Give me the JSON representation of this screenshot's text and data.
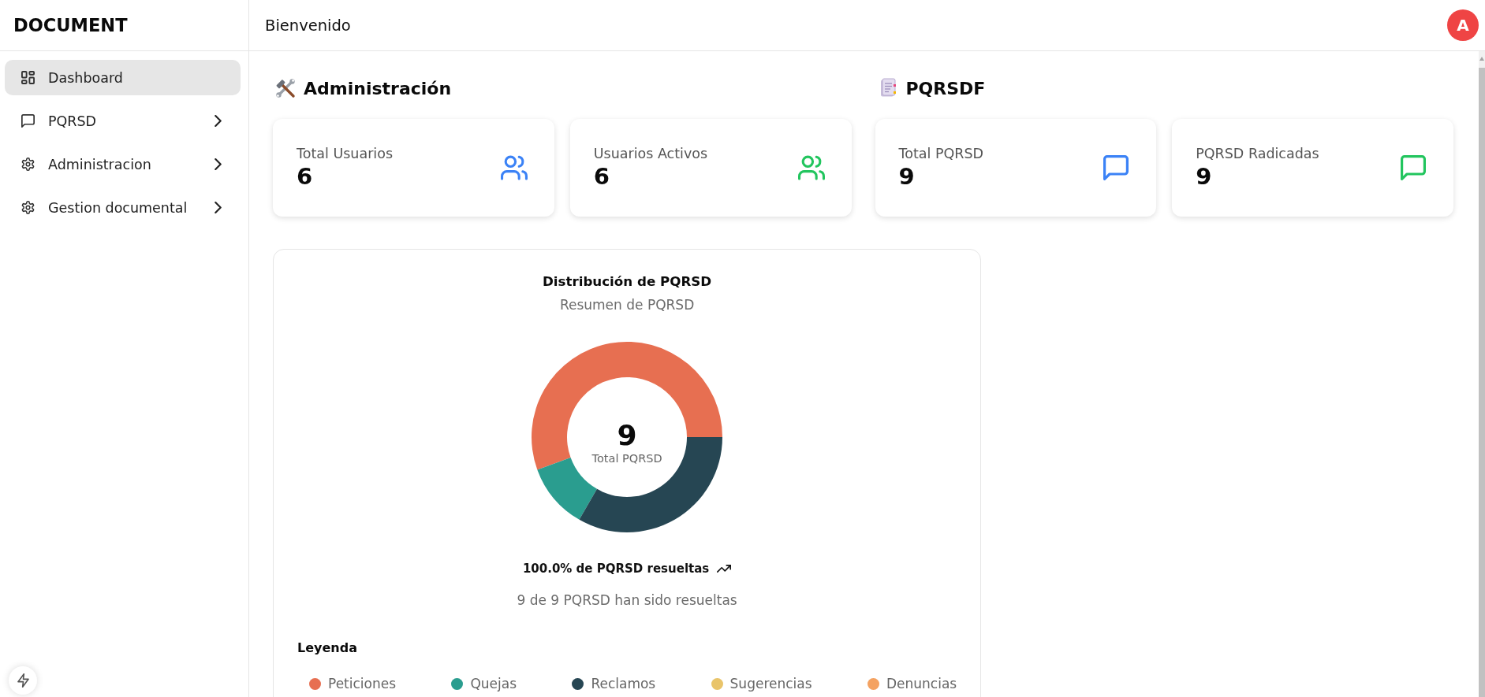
{
  "sidebar": {
    "logo": "DOCUMENT",
    "items": [
      {
        "label": "Dashboard",
        "selected": true,
        "expandable": false
      },
      {
        "label": "PQRSD",
        "selected": false,
        "expandable": true
      },
      {
        "label": "Administracion",
        "selected": false,
        "expandable": true
      },
      {
        "label": "Gestion documental",
        "selected": false,
        "expandable": true
      }
    ]
  },
  "header": {
    "title": "Bienvenido",
    "avatar": "A"
  },
  "sections": [
    {
      "title": "Administración",
      "cards": [
        {
          "label": "Total Usuarios",
          "value": "6",
          "color": "#3b82f6"
        },
        {
          "label": "Usuarios Activos",
          "value": "6",
          "color": "#22c55e"
        }
      ]
    },
    {
      "title": "PQRSDF",
      "cards": [
        {
          "label": "Total PQRSD",
          "value": "9",
          "color": "#3b82f6"
        },
        {
          "label": "PQRSD Radicadas",
          "value": "9",
          "color": "#22c55e"
        }
      ]
    }
  ],
  "chart_card": {
    "title": "Distribución de PQRSD",
    "subtitle": "Resumen de PQRSD",
    "chart_data": {
      "type": "donut",
      "categories": [
        "Peticiones",
        "Quejas",
        "Reclamos",
        "Sugerencias",
        "Denuncias"
      ],
      "values": [
        55.56,
        11.11,
        33.33,
        0,
        0
      ]
    },
    "center_value": "9",
    "center_label": "Total PQRSD",
    "summary": "100.0% de PQRSD resueltas",
    "detail": "9 de 9 PQRSD han sido resueltas",
    "legend": {
      "title": "Leyenda",
      "items": [
        {
          "color": "#e76f51"
        },
        {
          "color": "#2a9d8f"
        },
        {
          "color": "#264653"
        },
        {
          "color": "#e9c46a"
        },
        {
          "color": "#f4a261"
        }
      ]
    }
  }
}
